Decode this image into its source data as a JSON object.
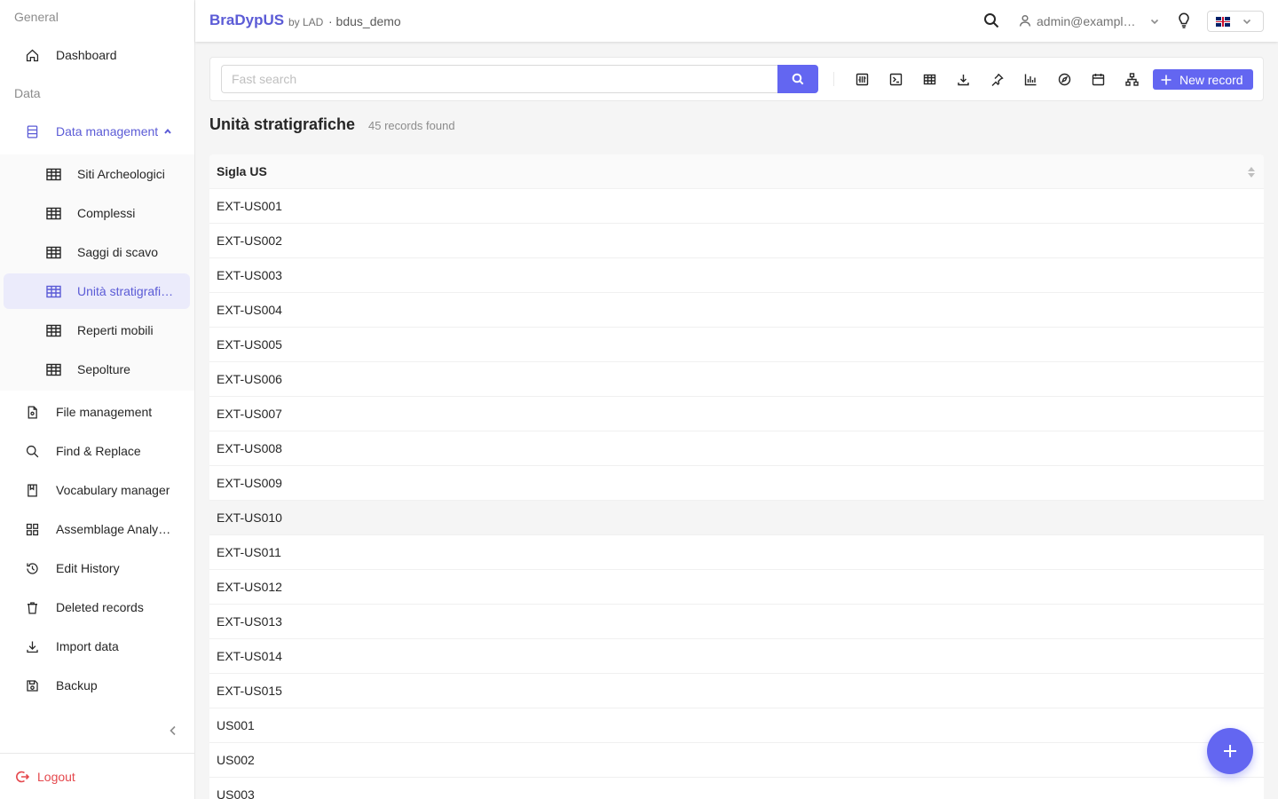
{
  "sidebar": {
    "general_label": "General",
    "data_label": "Data",
    "dashboard": "Dashboard",
    "data_management": "Data management",
    "sub_items": [
      {
        "label": "Siti Archeologici"
      },
      {
        "label": "Complessi"
      },
      {
        "label": "Saggi di scavo"
      },
      {
        "label": "Unità stratigrafiche",
        "active": true
      },
      {
        "label": "Reperti mobili"
      },
      {
        "label": "Sepolture"
      }
    ],
    "file_management": "File management",
    "find_replace": "Find & Replace",
    "vocabulary_manager": "Vocabulary manager",
    "assemblage_analysis": "Assemblage Analysis",
    "edit_history": "Edit History",
    "deleted_records": "Deleted records",
    "import_data": "Import data",
    "backup": "Backup",
    "logout": "Logout"
  },
  "header": {
    "brand": "BraDypUS",
    "brand_by": "by LAD",
    "database": "· bdus_demo",
    "user": "admin@example.com",
    "language_flag": "uk-flag-icon"
  },
  "toolbar": {
    "search_placeholder": "Fast search",
    "new_record_label": "New record",
    "icons": [
      "advanced-search-icon",
      "sql-terminal-icon",
      "table-icon",
      "export-icon",
      "pin-icon",
      "chart-icon",
      "compass-icon",
      "calendar-icon",
      "hierarchy-icon"
    ]
  },
  "main": {
    "title": "Unità stratigrafiche",
    "record_count": "45 records found"
  },
  "table": {
    "column": "Sigla US",
    "rows": [
      "EXT-US001",
      "EXT-US002",
      "EXT-US003",
      "EXT-US004",
      "EXT-US005",
      "EXT-US006",
      "EXT-US007",
      "EXT-US008",
      "EXT-US009",
      "EXT-US010",
      "EXT-US011",
      "EXT-US012",
      "EXT-US013",
      "EXT-US014",
      "EXT-US015",
      "US001",
      "US002",
      "US003"
    ],
    "hovered_row": "EXT-US010"
  },
  "colors": {
    "accent": "#6366f1",
    "danger": "#e5484d"
  }
}
